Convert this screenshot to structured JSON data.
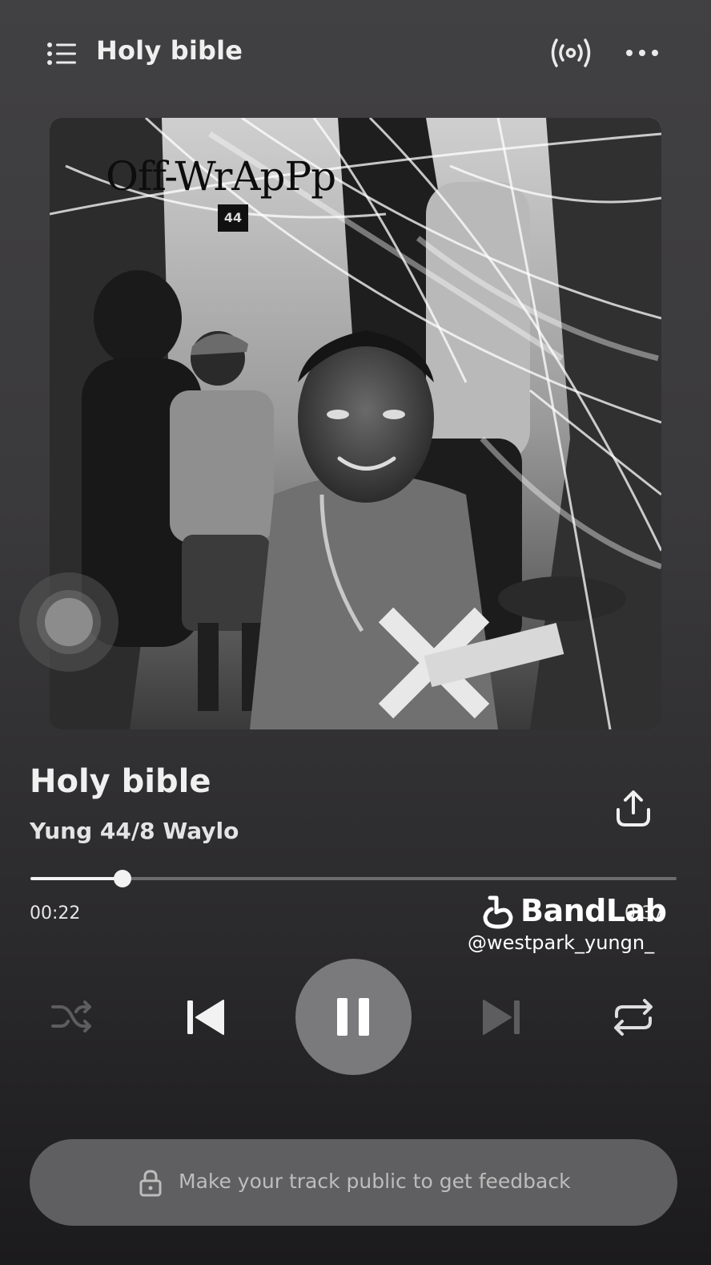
{
  "header": {
    "title": "Holy bible",
    "queue_icon": "list-icon",
    "cast_icon": "broadcast-icon",
    "more_icon": "more-horizontal-icon"
  },
  "artwork": {
    "logo_text": "Off-WrApPp",
    "badge_text": "44"
  },
  "track": {
    "title": "Holy bible",
    "artist": "Yung 44/8 Waylo",
    "share_icon": "share-upload-icon"
  },
  "playback": {
    "elapsed": "00:22",
    "total": "0:37",
    "progress_fraction": 0.143,
    "state": "playing"
  },
  "watermark": {
    "brand": "BandLab",
    "handle": "@westpark_yungn_"
  },
  "controls": {
    "shuffle_icon": "shuffle-icon",
    "previous_icon": "skip-previous-icon",
    "pause_icon": "pause-icon",
    "next_icon": "skip-next-icon",
    "repeat_icon": "repeat-icon"
  },
  "feedback": {
    "text": "Make your track public to get feedback",
    "icon": "lock-icon"
  },
  "colors": {
    "background_top": "#414042",
    "background_bottom": "#1b1a1c",
    "play_button": "#7a797b",
    "pill": "#5f5e60",
    "text_primary": "#f0f0f0",
    "text_muted": "#bdbdbd"
  }
}
